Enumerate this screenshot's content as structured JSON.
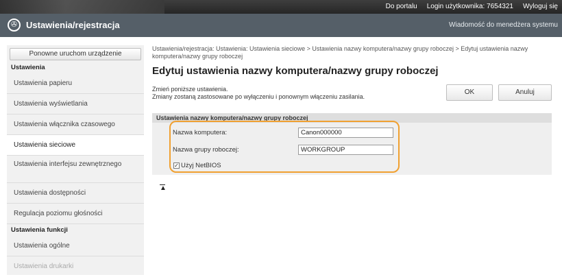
{
  "topbar": {
    "portal_link": "Do portalu",
    "login_label": "Login użytkownika:",
    "user_id": "7654321",
    "logout": "Wyloguj się"
  },
  "header": {
    "title": "Ustawienia/rejestracja",
    "logo_glyph": "✇",
    "admin_message": "Wiadomość do menedżera systemu"
  },
  "sidebar": {
    "restart_button": "Ponowne uruchom urządzenie",
    "section_settings": "Ustawienia",
    "items": [
      "Ustawienia papieru",
      "Ustawienia wyświetlania",
      "Ustawienia włącznika czasowego",
      "Ustawienia sieciowe",
      "Ustawienia interfejsu zewnętrznego",
      "Ustawienia dostępności",
      "Regulacja poziomu głośności"
    ],
    "section_functions": "Ustawienia funkcji",
    "function_items": [
      "Ustawienia ogólne",
      "Ustawienia drukarki"
    ]
  },
  "main": {
    "breadcrumb": "Ustawienia/rejestracja: Ustawienia: Ustawienia sieciowe > Ustawienia nazwy komputera/nazwy grupy roboczej > Edytuj ustawienia nazwy komputera/nazwy grupy roboczej",
    "page_title": "Edytuj ustawienia nazwy komputera/nazwy grupy roboczej",
    "desc_line1": "Zmień poniższe ustawienia.",
    "desc_line2": "Zmiany zostaną zastosowane po wyłączeniu i ponownym włączeniu zasilania.",
    "ok_button": "OK",
    "cancel_button": "Anuluj",
    "section_title": "Ustawienia nazwy komputera/nazwy grupy roboczej",
    "computer_name_label": "Nazwa komputera:",
    "computer_name_value": "Canon000000",
    "workgroup_label": "Nazwa grupy roboczej:",
    "workgroup_value": "WORKGROUP",
    "netbios_label": "Użyj NetBIOS",
    "netbios_checked": true,
    "scroll_top_glyph": "▲"
  },
  "colors": {
    "highlight": "#f0a030",
    "titlebar": "#555f68"
  }
}
